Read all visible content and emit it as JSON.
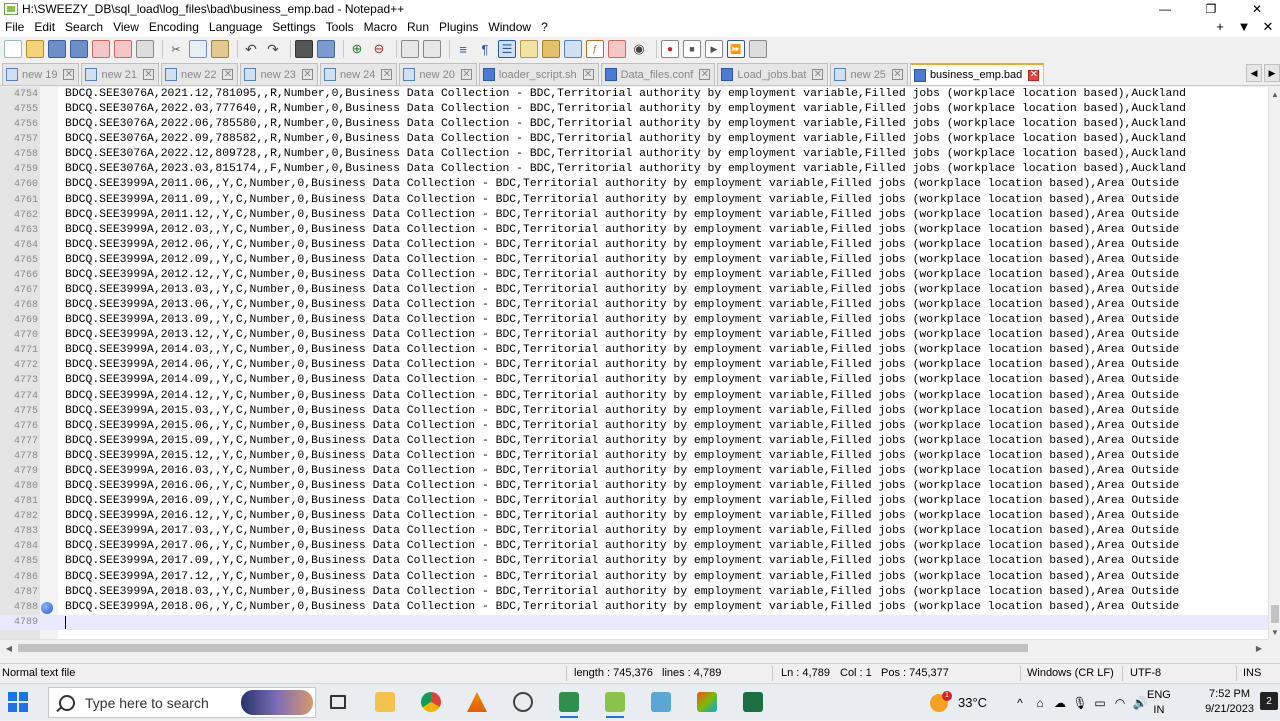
{
  "window": {
    "title": "H:\\SWEEZY_DB\\sql_load\\log_files\\bad\\business_emp.bad - Notepad++",
    "minimize": "—",
    "maximize": "❐",
    "close": "✕"
  },
  "menu": {
    "items": [
      "File",
      "Edit",
      "Search",
      "View",
      "Encoding",
      "Language",
      "Settings",
      "Tools",
      "Macro",
      "Run",
      "Plugins",
      "Window",
      "?"
    ],
    "right_plus": "+",
    "right_down": "▼",
    "right_close": "✕"
  },
  "tabs": [
    {
      "label": "new 19",
      "icon": "file-icon",
      "active": false
    },
    {
      "label": "new 21",
      "icon": "file-icon",
      "active": false
    },
    {
      "label": "new 22",
      "icon": "file-icon",
      "active": false
    },
    {
      "label": "new 23",
      "icon": "file-icon",
      "active": false
    },
    {
      "label": "new 24",
      "icon": "file-icon",
      "active": false
    },
    {
      "label": "new 20",
      "icon": "file-icon",
      "active": false
    },
    {
      "label": "loader_script.sh",
      "icon": "file-icon",
      "active": false
    },
    {
      "label": "Data_files.conf",
      "icon": "file-icon",
      "active": false
    },
    {
      "label": "Load_jobs.bat",
      "icon": "file-icon",
      "active": false
    },
    {
      "label": "new 25",
      "icon": "file-icon",
      "active": false
    },
    {
      "label": "business_emp.bad",
      "icon": "file-icon",
      "active": true
    }
  ],
  "editor": {
    "lines": [
      {
        "n": "4754",
        "text": "BDCQ.SEE3076A,2021.12,781095,,R,Number,0,Business Data Collection - BDC,Territorial authority by employment variable,Filled jobs (workplace location based),Auckland"
      },
      {
        "n": "4755",
        "text": "BDCQ.SEE3076A,2022.03,777640,,R,Number,0,Business Data Collection - BDC,Territorial authority by employment variable,Filled jobs (workplace location based),Auckland"
      },
      {
        "n": "4756",
        "text": "BDCQ.SEE3076A,2022.06,785580,,R,Number,0,Business Data Collection - BDC,Territorial authority by employment variable,Filled jobs (workplace location based),Auckland"
      },
      {
        "n": "4757",
        "text": "BDCQ.SEE3076A,2022.09,788582,,R,Number,0,Business Data Collection - BDC,Territorial authority by employment variable,Filled jobs (workplace location based),Auckland"
      },
      {
        "n": "4758",
        "text": "BDCQ.SEE3076A,2022.12,809728,,R,Number,0,Business Data Collection - BDC,Territorial authority by employment variable,Filled jobs (workplace location based),Auckland"
      },
      {
        "n": "4759",
        "text": "BDCQ.SEE3076A,2023.03,815174,,F,Number,0,Business Data Collection - BDC,Territorial authority by employment variable,Filled jobs (workplace location based),Auckland"
      },
      {
        "n": "4760",
        "text": "BDCQ.SEE3999A,2011.06,,Y,C,Number,0,Business Data Collection - BDC,Territorial authority by employment variable,Filled jobs (workplace location based),Area Outside"
      },
      {
        "n": "4761",
        "text": "BDCQ.SEE3999A,2011.09,,Y,C,Number,0,Business Data Collection - BDC,Territorial authority by employment variable,Filled jobs (workplace location based),Area Outside"
      },
      {
        "n": "4762",
        "text": "BDCQ.SEE3999A,2011.12,,Y,C,Number,0,Business Data Collection - BDC,Territorial authority by employment variable,Filled jobs (workplace location based),Area Outside"
      },
      {
        "n": "4763",
        "text": "BDCQ.SEE3999A,2012.03,,Y,C,Number,0,Business Data Collection - BDC,Territorial authority by employment variable,Filled jobs (workplace location based),Area Outside"
      },
      {
        "n": "4764",
        "text": "BDCQ.SEE3999A,2012.06,,Y,C,Number,0,Business Data Collection - BDC,Territorial authority by employment variable,Filled jobs (workplace location based),Area Outside"
      },
      {
        "n": "4765",
        "text": "BDCQ.SEE3999A,2012.09,,Y,C,Number,0,Business Data Collection - BDC,Territorial authority by employment variable,Filled jobs (workplace location based),Area Outside"
      },
      {
        "n": "4766",
        "text": "BDCQ.SEE3999A,2012.12,,Y,C,Number,0,Business Data Collection - BDC,Territorial authority by employment variable,Filled jobs (workplace location based),Area Outside"
      },
      {
        "n": "4767",
        "text": "BDCQ.SEE3999A,2013.03,,Y,C,Number,0,Business Data Collection - BDC,Territorial authority by employment variable,Filled jobs (workplace location based),Area Outside"
      },
      {
        "n": "4768",
        "text": "BDCQ.SEE3999A,2013.06,,Y,C,Number,0,Business Data Collection - BDC,Territorial authority by employment variable,Filled jobs (workplace location based),Area Outside"
      },
      {
        "n": "4769",
        "text": "BDCQ.SEE3999A,2013.09,,Y,C,Number,0,Business Data Collection - BDC,Territorial authority by employment variable,Filled jobs (workplace location based),Area Outside"
      },
      {
        "n": "4770",
        "text": "BDCQ.SEE3999A,2013.12,,Y,C,Number,0,Business Data Collection - BDC,Territorial authority by employment variable,Filled jobs (workplace location based),Area Outside"
      },
      {
        "n": "4771",
        "text": "BDCQ.SEE3999A,2014.03,,Y,C,Number,0,Business Data Collection - BDC,Territorial authority by employment variable,Filled jobs (workplace location based),Area Outside"
      },
      {
        "n": "4772",
        "text": "BDCQ.SEE3999A,2014.06,,Y,C,Number,0,Business Data Collection - BDC,Territorial authority by employment variable,Filled jobs (workplace location based),Area Outside"
      },
      {
        "n": "4773",
        "text": "BDCQ.SEE3999A,2014.09,,Y,C,Number,0,Business Data Collection - BDC,Territorial authority by employment variable,Filled jobs (workplace location based),Area Outside"
      },
      {
        "n": "4774",
        "text": "BDCQ.SEE3999A,2014.12,,Y,C,Number,0,Business Data Collection - BDC,Territorial authority by employment variable,Filled jobs (workplace location based),Area Outside"
      },
      {
        "n": "4775",
        "text": "BDCQ.SEE3999A,2015.03,,Y,C,Number,0,Business Data Collection - BDC,Territorial authority by employment variable,Filled jobs (workplace location based),Area Outside"
      },
      {
        "n": "4776",
        "text": "BDCQ.SEE3999A,2015.06,,Y,C,Number,0,Business Data Collection - BDC,Territorial authority by employment variable,Filled jobs (workplace location based),Area Outside"
      },
      {
        "n": "4777",
        "text": "BDCQ.SEE3999A,2015.09,,Y,C,Number,0,Business Data Collection - BDC,Territorial authority by employment variable,Filled jobs (workplace location based),Area Outside"
      },
      {
        "n": "4778",
        "text": "BDCQ.SEE3999A,2015.12,,Y,C,Number,0,Business Data Collection - BDC,Territorial authority by employment variable,Filled jobs (workplace location based),Area Outside"
      },
      {
        "n": "4779",
        "text": "BDCQ.SEE3999A,2016.03,,Y,C,Number,0,Business Data Collection - BDC,Territorial authority by employment variable,Filled jobs (workplace location based),Area Outside"
      },
      {
        "n": "4780",
        "text": "BDCQ.SEE3999A,2016.06,,Y,C,Number,0,Business Data Collection - BDC,Territorial authority by employment variable,Filled jobs (workplace location based),Area Outside"
      },
      {
        "n": "4781",
        "text": "BDCQ.SEE3999A,2016.09,,Y,C,Number,0,Business Data Collection - BDC,Territorial authority by employment variable,Filled jobs (workplace location based),Area Outside"
      },
      {
        "n": "4782",
        "text": "BDCQ.SEE3999A,2016.12,,Y,C,Number,0,Business Data Collection - BDC,Territorial authority by employment variable,Filled jobs (workplace location based),Area Outside"
      },
      {
        "n": "4783",
        "text": "BDCQ.SEE3999A,2017.03,,Y,C,Number,0,Business Data Collection - BDC,Territorial authority by employment variable,Filled jobs (workplace location based),Area Outside"
      },
      {
        "n": "4784",
        "text": "BDCQ.SEE3999A,2017.06,,Y,C,Number,0,Business Data Collection - BDC,Territorial authority by employment variable,Filled jobs (workplace location based),Area Outside"
      },
      {
        "n": "4785",
        "text": "BDCQ.SEE3999A,2017.09,,Y,C,Number,0,Business Data Collection - BDC,Territorial authority by employment variable,Filled jobs (workplace location based),Area Outside"
      },
      {
        "n": "4786",
        "text": "BDCQ.SEE3999A,2017.12,,Y,C,Number,0,Business Data Collection - BDC,Territorial authority by employment variable,Filled jobs (workplace location based),Area Outside"
      },
      {
        "n": "4787",
        "text": "BDCQ.SEE3999A,2018.03,,Y,C,Number,0,Business Data Collection - BDC,Territorial authority by employment variable,Filled jobs (workplace location based),Area Outside"
      },
      {
        "n": "4788",
        "text": "BDCQ.SEE3999A,2018.06,,Y,C,Number,0,Business Data Collection - BDC,Territorial authority by employment variable,Filled jobs (workplace location based),Area Outside",
        "bookmark": true
      },
      {
        "n": "4789",
        "text": "",
        "current": true
      }
    ]
  },
  "status": {
    "file_type": "Normal text file",
    "length": "length : 745,376",
    "lines": "lines : 4,789",
    "ln": "Ln : 4,789",
    "col": "Col : 1",
    "pos": "Pos : 745,377",
    "eol": "Windows (CR LF)",
    "encoding": "UTF-8",
    "mode": "INS"
  },
  "taskbar": {
    "search_placeholder": "Type here to search",
    "weather_temp": "33°C",
    "weather_badge": "1",
    "lang": "ENG",
    "region": "IN",
    "time": "7:52 PM",
    "date": "9/21/2023",
    "notification_count": "2",
    "tray_chevron": "^"
  },
  "colors": {
    "active_tab_accent": "#f6a623",
    "current_line": "#e8e8ff",
    "bookmark": "#2a59d8"
  }
}
